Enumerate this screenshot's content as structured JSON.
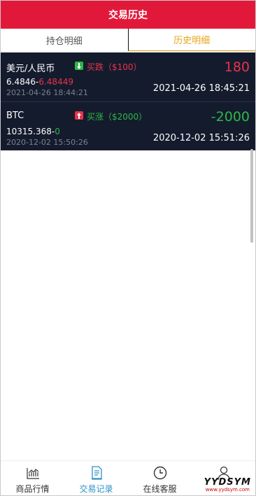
{
  "header": {
    "title": "交易历史"
  },
  "tabs": [
    {
      "label": "持仓明细",
      "active": false
    },
    {
      "label": "历史明细",
      "active": true
    }
  ],
  "trades": [
    {
      "symbol": "美元/人民币",
      "direction_icon": "arrow-down-icon",
      "action": "买跌（$100）",
      "open_price": "6.4846",
      "close_price": "6.48449",
      "open_time": "2021-04-26 18:44:21",
      "profit": "180",
      "close_time": "2021-04-26 18:45:21"
    },
    {
      "symbol": "BTC",
      "direction_icon": "arrow-up-icon",
      "action": "买涨（$2000）",
      "open_price": "10315.368",
      "close_price": "0",
      "open_time": "2020-12-02 15:50:26",
      "profit": "-2000",
      "close_time": "2020-12-02 15:51:26"
    }
  ],
  "tabbar": [
    {
      "label": "商品行情",
      "icon": "chart-icon"
    },
    {
      "label": "交易记录",
      "icon": "document-icon",
      "active": true
    },
    {
      "label": "在线客服",
      "icon": "clock-icon"
    },
    {
      "label": "",
      "icon": "user-icon"
    }
  ],
  "watermark": {
    "big": "YYDSYM",
    "small": "www.yydsym.com"
  },
  "colors": {
    "header": "#e2183a",
    "row_bg": "#141b2d",
    "loss": "#e8334a",
    "gain": "#2eb846",
    "active_tab": "#e8a317",
    "active_nav": "#2f8fc4"
  }
}
